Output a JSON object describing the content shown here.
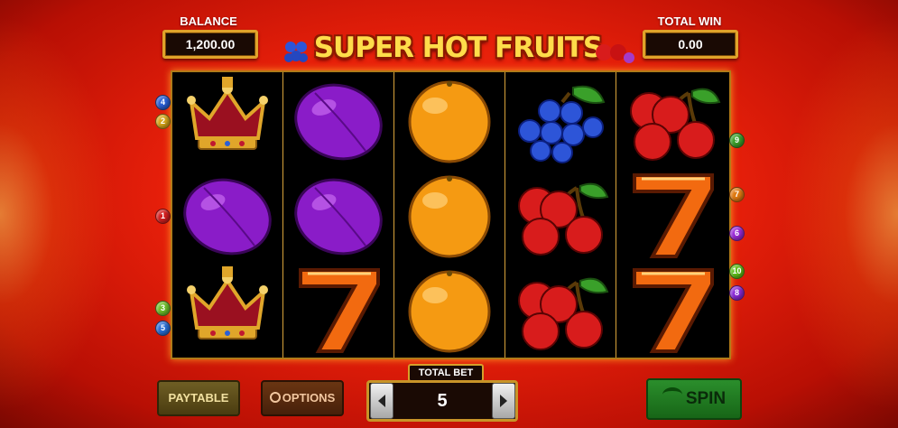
{
  "header": {
    "balance_label": "BALANCE",
    "balance_value": "1,200.00",
    "total_win_label": "TOTAL WIN",
    "total_win_value": "0.00",
    "logo_text": "SUPER HOT FRUITS"
  },
  "reels": [
    [
      "crown",
      "plum",
      "crown"
    ],
    [
      "plum",
      "plum",
      "seven"
    ],
    [
      "orange",
      "orange",
      "orange"
    ],
    [
      "grapes",
      "cherry",
      "cherry"
    ],
    [
      "cherry",
      "seven",
      "seven"
    ]
  ],
  "paylines_left": [
    "4",
    "2",
    "1",
    "3",
    "5"
  ],
  "paylines_right": [
    "9",
    "7",
    "6",
    "10",
    "8"
  ],
  "payline_colors": {
    "1": "#d42020",
    "2": "#d6a51a",
    "3": "#6fbf2a",
    "4": "#2a5fd6",
    "5": "#2a6fd6",
    "6": "#9a2ad6",
    "7": "#e07a12",
    "8": "#8a2ad6",
    "9": "#3aa02a",
    "10": "#5fbf1a"
  },
  "controls": {
    "paytable_label": "PAYTABLE",
    "options_label": "OPTIONS",
    "total_bet_label": "TOTAL BET",
    "total_bet_value": "5",
    "spin_label": "SPIN",
    "bet_decrease_icon": "chevron-left-icon",
    "bet_increase_icon": "chevron-right-icon"
  }
}
